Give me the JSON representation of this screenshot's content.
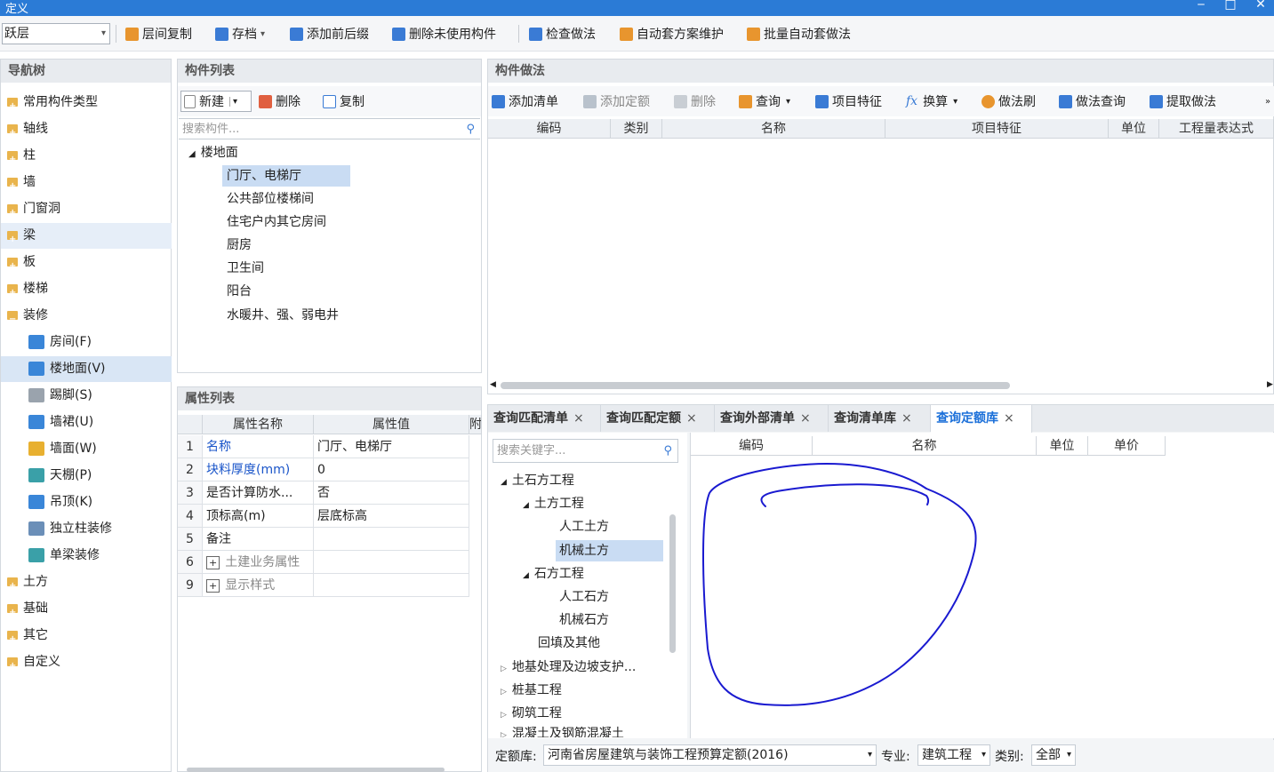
{
  "window": {
    "title": "定义",
    "minimize": "‒",
    "maximize": "□",
    "close": "✕"
  },
  "toolbar": {
    "floor": "跃层",
    "items": [
      "层间复制",
      "存档",
      "添加前后缀",
      "删除未使用构件",
      "检查做法",
      "自动套方案维护",
      "批量自动套做法"
    ],
    "colors": {
      "icon_blue": "#3a7bd5",
      "icon_orange": "#e8952e"
    }
  },
  "nav": {
    "title": "导航树",
    "items": [
      "常用构件类型",
      "轴线",
      "柱",
      "墙",
      "门窗洞",
      "梁",
      "板",
      "楼梯",
      "装修"
    ],
    "sub_items": [
      "房间(F)",
      "楼地面(V)",
      "踢脚(S)",
      "墙裙(U)",
      "墙面(W)",
      "天棚(P)",
      "吊顶(K)",
      "独立柱装修",
      "单梁装修"
    ],
    "bottom_items": [
      "土方",
      "基础",
      "其它",
      "自定义"
    ]
  },
  "comp_list": {
    "title": "构件列表",
    "new_label": "新建",
    "delete_label": "删除",
    "copy_label": "复制",
    "search_placeholder": "搜索构件...",
    "root": "楼地面",
    "children": [
      "门厅、电梯厅",
      "公共部位楼梯间",
      "住宅户内其它房间",
      "厨房",
      "卫生间",
      "阳台",
      "水暖井、强、弱电井"
    ]
  },
  "props": {
    "title": "属性列表",
    "col_name": "属性名称",
    "col_value": "属性值",
    "col_extra": "附",
    "rows": [
      {
        "no": "1",
        "name": "名称",
        "value": "门厅、电梯厅"
      },
      {
        "no": "2",
        "name": "块料厚度(mm)",
        "value": "0"
      },
      {
        "no": "3",
        "name": "是否计算防水...",
        "value": "否"
      },
      {
        "no": "4",
        "name": "顶标高(m)",
        "value": "层底标高"
      },
      {
        "no": "5",
        "name": "备注",
        "value": ""
      },
      {
        "no": "6",
        "name": "土建业务属性",
        "value": ""
      },
      {
        "no": "9",
        "name": "显示样式",
        "value": ""
      }
    ],
    "expand_icon": "+"
  },
  "method": {
    "title": "构件做法",
    "toolbar": [
      "添加清单",
      "添加定额",
      "删除",
      "查询",
      "项目特征",
      "换算",
      "做法刷",
      "做法查询",
      "提取做法"
    ],
    "columns": [
      "编码",
      "类别",
      "名称",
      "项目特征",
      "单位",
      "工程量表达式"
    ]
  },
  "query": {
    "tabs": [
      "查询匹配清单",
      "查询匹配定额",
      "查询外部清单",
      "查询清单库",
      "查询定额库"
    ],
    "close": "×",
    "search_placeholder": "搜索关键字...",
    "tree": {
      "n1": "土石方工程",
      "n2": "土方工程",
      "n3": "人工土方",
      "n4": "机械土方",
      "n5": "石方工程",
      "n6": "人工石方",
      "n7": "机械石方",
      "n8": "回填及其他",
      "n9": "地基处理及边坡支护...",
      "n10": "桩基工程",
      "n11": "砌筑工程",
      "n12": "混凝土及钢筋混凝土"
    },
    "columns": [
      "编码",
      "名称",
      "单位",
      "单价"
    ],
    "footer": {
      "lib_label": "定额库:",
      "lib_value": "河南省房屋建筑与装饰工程预算定额(2016)",
      "spec_label": "专业:",
      "spec_value": "建筑工程",
      "cat_label": "类别:",
      "cat_value": "全部"
    }
  },
  "annotation": {
    "color": "#1a1ad0"
  }
}
